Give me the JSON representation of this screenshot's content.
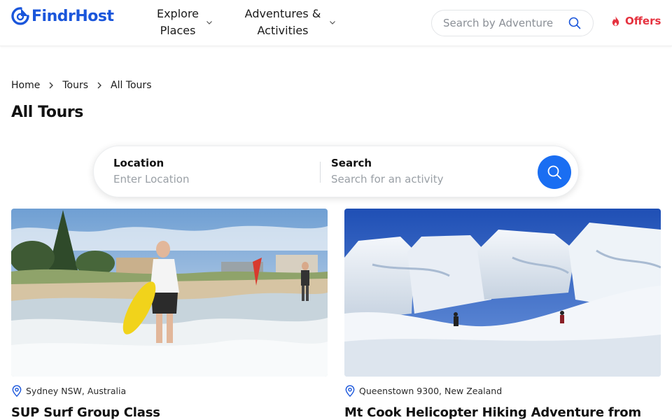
{
  "brand": {
    "name": "FindrHost",
    "color": "#1a56db"
  },
  "nav": {
    "items": [
      {
        "label": "Explore Places",
        "icon": "chevron-down-icon"
      },
      {
        "label": "Adventures & Activities",
        "icon": "chevron-down-icon"
      }
    ]
  },
  "header_search": {
    "placeholder": "Search by Adventure",
    "icon": "search-icon"
  },
  "offers": {
    "label": "Offers",
    "icon": "flame-icon",
    "color": "#e5323f"
  },
  "breadcrumb": [
    "Home",
    "Tours",
    "All Tours"
  ],
  "page": {
    "title": "All Tours"
  },
  "search_bar": {
    "location_title": "Location",
    "location_placeholder": "Enter Location",
    "search_title": "Search",
    "search_placeholder": "Search for an activity",
    "button_icon": "search-icon",
    "button_color": "#1a6ef2"
  },
  "tours": [
    {
      "location": "Sydney NSW, Australia",
      "title": "SUP Surf Group Class",
      "image": "beach-surfer-photo"
    },
    {
      "location": "Queenstown 9300, New Zealand",
      "title": "Mt Cook Helicopter Hiking Adventure from",
      "image": "glacier-hikers-photo"
    }
  ]
}
